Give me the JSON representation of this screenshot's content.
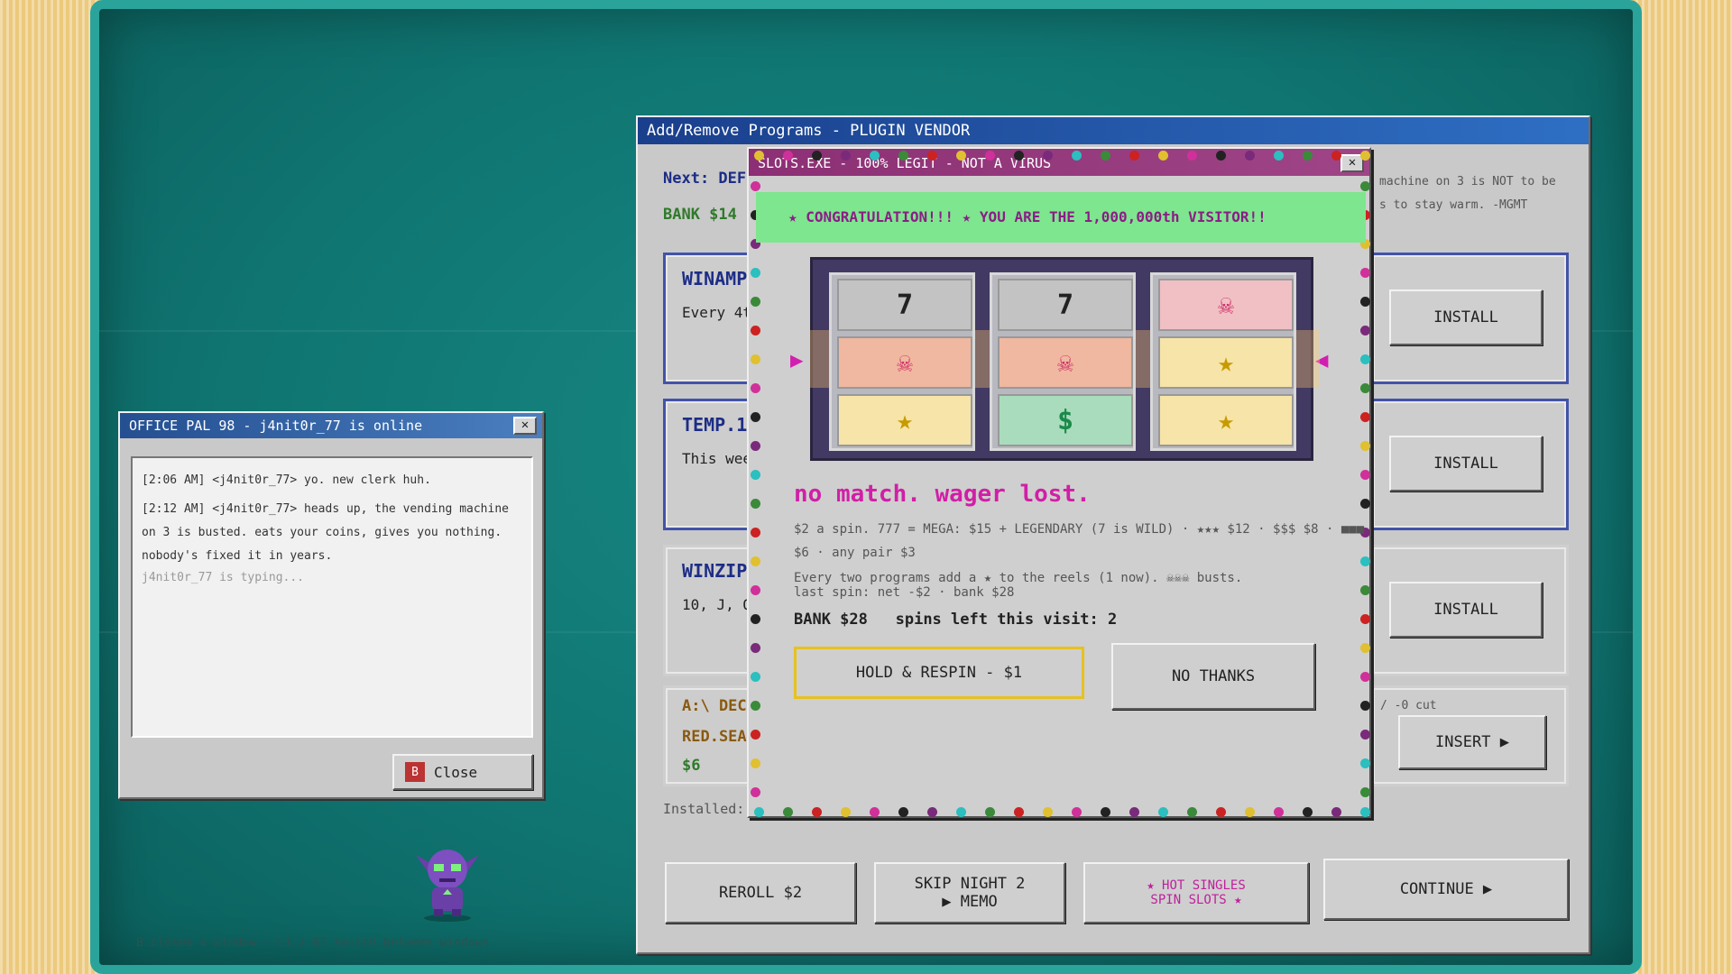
{
  "vendor": {
    "title": "Add/Remove Programs - PLUGIN VENDOR",
    "next_label": "Next: DEF",
    "bank_label": "BANK $14",
    "memo_line1": "machine on 3 is NOT to be",
    "memo_line2": "s to stay warm. -MGMT",
    "cards": [
      {
        "title": "WINAMP",
        "text": "Every 4t",
        "button": "INSTALL"
      },
      {
        "title": "TEMP.1",
        "text": "This wee",
        "button": "INSTALL"
      },
      {
        "title": "WINZIP",
        "text": "10, J, Q",
        "button": "INSTALL"
      }
    ],
    "deck": {
      "line1": "A:\\ DECK",
      "line2": "RED.SEA",
      "price": "$6",
      "cut": "/ -0 cut",
      "button": "INSERT ▶"
    },
    "installed": "Installed: n",
    "bottom_buttons": {
      "reroll": "REROLL $2",
      "skip_line1": "SKIP NIGHT 2",
      "skip_line2": "▶ MEMO",
      "hot_line1": "★ HOT SINGLES",
      "hot_line2": "SPIN SLOTS ★",
      "continue": "CONTINUE ▶"
    }
  },
  "chat": {
    "title": "OFFICE PAL 98 - j4nit0r_77 is online",
    "messages": [
      "[2:06 AM] <j4nit0r_77>  yo. new clerk huh.",
      "[2:12 AM] <j4nit0r_77>  heads up, the vending machine on 3 is busted. eats your coins, gives you nothing. nobody's fixed it in years."
    ],
    "typing": "j4nit0r_77 is typing...",
    "close_key": "B",
    "close_label": "Close"
  },
  "slots": {
    "title": "SLOTS.EXE - 100% LEGIT - NOT A VIRUS",
    "congrats": "★ CONGRATULATION!!! ★  YOU ARE THE 1,000,000th VISITOR!!",
    "reels": [
      [
        "7",
        "☠",
        "★"
      ],
      [
        "7",
        "☠",
        "$"
      ],
      [
        "☠",
        "★",
        "★"
      ]
    ],
    "result": "no match. wager lost.",
    "rules_line1": "$2 a spin.  777 = MEGA: $15 + LEGENDARY (7 is WILD)  ·  ★★★ $12  ·  $$$ $8  ·  ■■■",
    "rules_line2": "$6  ·  any pair $3",
    "rules_line3": "Every two programs add a ★ to the reels (1 now). ☠☠☠ busts.",
    "rules_line4": "last spin: net -$2   ·  bank $28",
    "bank": "BANK $28",
    "spins": "spins left this visit: 2",
    "hold_button": "HOLD & RESPIN - $1",
    "no_thanks_button": "NO THANKS"
  },
  "hint": "B closes a window  ·  L1 / R1 switch between windows",
  "colors": {
    "screen": "#107672",
    "title_blue": "#1a3f8c",
    "slots_title": "#8c2f74",
    "congrats_bg": "#7ee68f",
    "result_magenta": "#d11fa6",
    "hold_border": "#e6c21e"
  }
}
